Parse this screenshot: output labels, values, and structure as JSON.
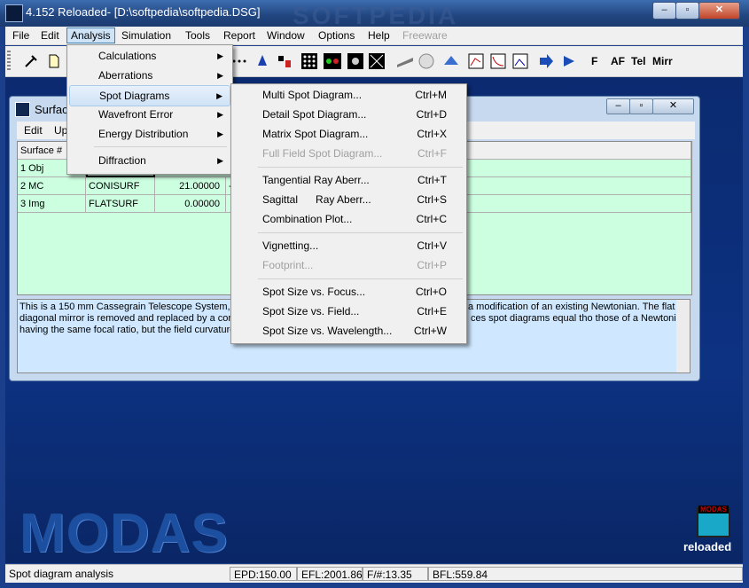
{
  "app": {
    "title": "4.152 Reloaded- [D:\\softpedia\\softpedia.DSG]",
    "watermark": "SOFTPEDIA",
    "brand_big": "MODAS",
    "logo_caption": "reloaded",
    "logo_small": "MODAS"
  },
  "window_controls": {
    "minimize": "‒",
    "maximize": "▫",
    "close": "✕"
  },
  "menubar": {
    "items": [
      "File",
      "Edit",
      "Analysis",
      "Simulation",
      "Tools",
      "Report",
      "Window",
      "Options",
      "Help",
      "Freeware"
    ]
  },
  "toolbar": {
    "text_buttons": [
      "F",
      "AF",
      "Tel",
      "Mirr"
    ]
  },
  "child_window": {
    "title": "Surface",
    "controls": {
      "minimize": "‒",
      "maximize": "▫",
      "close": "✕"
    },
    "menu": [
      "Edit",
      "Up"
    ],
    "table": {
      "header": "Surface #",
      "rows": [
        {
          "num": "1 Obj",
          "type": "",
          "value": "",
          "extra": ""
        },
        {
          "num": "2 MC",
          "type": "CONISURF",
          "value": "21.00000",
          "extra": "-"
        },
        {
          "num": "3 Img",
          "type": "FLATSURF",
          "value": "0.00000",
          "extra": ""
        }
      ]
    },
    "description": {
      "line1_left": "This is a 150 mm Cassegrain Telescope System, f/",
      "line1_right": "a modification of an existing Newtonian. The flat",
      "line2_left": "diagonal mirror is removed and replaced by a conv",
      "line2_right": "ces spot diagrams equal tho those of a Newtonian",
      "line3_left": "having the same focal ratio, but the field curvature"
    }
  },
  "analysis_menu": {
    "items": [
      "Calculations",
      "Aberrations",
      "Spot Diagrams",
      "Wavefront Error",
      "Energy Distribution",
      "Diffraction"
    ]
  },
  "spot_menu": {
    "items": [
      {
        "label": "Multi Spot Diagram...",
        "shortcut": "Ctrl+M",
        "enabled": true
      },
      {
        "label": "Detail Spot Diagram...",
        "shortcut": "Ctrl+D",
        "enabled": true
      },
      {
        "label": "Matrix Spot Diagram...",
        "shortcut": "Ctrl+X",
        "enabled": true
      },
      {
        "label": "Full Field Spot Diagram...",
        "shortcut": "Ctrl+F",
        "enabled": false
      },
      {
        "label": "Tangential Ray Aberr...",
        "shortcut": "Ctrl+T",
        "enabled": true
      },
      {
        "label": "Sagittal      Ray Aberr...",
        "shortcut": "Ctrl+S",
        "enabled": true
      },
      {
        "label": "Combination Plot...",
        "shortcut": "Ctrl+C",
        "enabled": true
      },
      {
        "label": "Vignetting...",
        "shortcut": "Ctrl+V",
        "enabled": true
      },
      {
        "label": "Footprint...",
        "shortcut": "Ctrl+P",
        "enabled": false
      },
      {
        "label": "Spot Size vs. Focus...",
        "shortcut": "Ctrl+O",
        "enabled": true
      },
      {
        "label": "Spot Size vs. Field...",
        "shortcut": "Ctrl+E",
        "enabled": true
      },
      {
        "label": "Spot Size vs. Wavelength...",
        "shortcut": "Ctrl+W",
        "enabled": true
      }
    ]
  },
  "statusbar": {
    "message": "Spot diagram analysis",
    "epd": "EPD:150.00",
    "efl": "EFL:2001.86",
    "fnum": "F/#:13.35",
    "bfl": "BFL:559.84"
  }
}
